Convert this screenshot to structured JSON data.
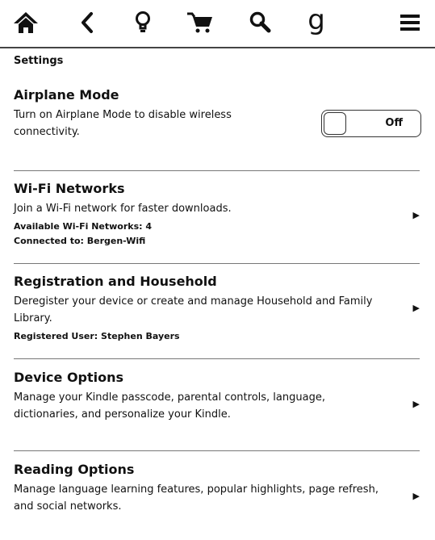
{
  "toolbar": {
    "icons": [
      "home-icon",
      "back-icon",
      "lightbulb-icon",
      "cart-icon",
      "search-icon",
      "goodreads-icon",
      "menu-icon"
    ],
    "goodreads_glyph": "g"
  },
  "page": {
    "title": "Settings"
  },
  "airplane": {
    "title": "Airplane Mode",
    "desc": "Turn on Airplane Mode to disable wireless connectivity.",
    "toggle_label": "Off"
  },
  "wifi": {
    "title": "Wi-Fi Networks",
    "desc": "Join a Wi-Fi network for faster downloads.",
    "available": "Available Wi-Fi Networks: 4",
    "connected": "Connected to: Bergen-Wifi"
  },
  "registration": {
    "title": "Registration and Household",
    "desc": "Deregister your device or create and manage Household and Family Library.",
    "user": "Registered User: Stephen Bayers"
  },
  "device": {
    "title": "Device Options",
    "desc": "Manage your Kindle passcode, parental controls, language, dictionaries, and personalize your Kindle."
  },
  "reading": {
    "title": "Reading Options",
    "desc": "Manage language learning features, popular highlights, page refresh, and social networks."
  },
  "arrow_glyph": "▶"
}
